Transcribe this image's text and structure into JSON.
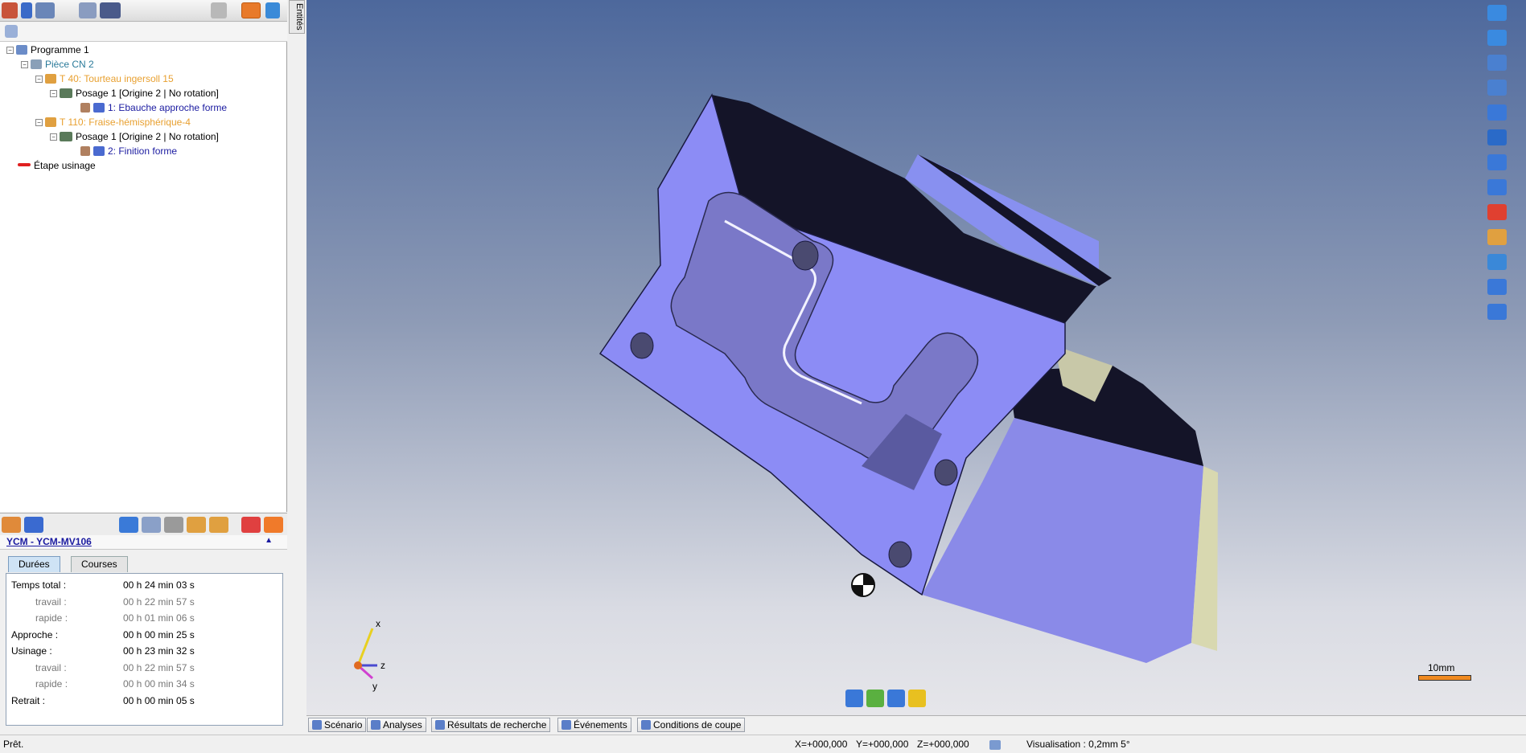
{
  "side_tab": "Entités",
  "tree": {
    "root": "Programme 1",
    "piece": "Pièce CN 2",
    "tool1": "T 40: Tourteau ingersoll 15",
    "posage1": "Posage 1 [Origine 2 | No rotation]",
    "op1": "1: Ebauche approche forme",
    "tool2": "T 110: Fraise-hémisphérique-4",
    "posage2": "Posage 1 [Origine 2 | No rotation]",
    "op2": "2: Finition forme",
    "etape": "Étape usinage"
  },
  "machine": {
    "name": "YCM - YCM-MV106",
    "collapse_glyph": "▲"
  },
  "tabs": {
    "durees": "Durées",
    "courses": "Courses"
  },
  "times": [
    {
      "label": "Temps total :",
      "value": "00 h 24 min 03 s",
      "sub": false
    },
    {
      "label": "travail :",
      "value": "00 h 22 min 57 s",
      "sub": true
    },
    {
      "label": "rapide :",
      "value": "00 h 01 min 06 s",
      "sub": true
    },
    {
      "label": "Approche :",
      "value": "00 h 00 min 25 s",
      "sub": false
    },
    {
      "label": "Usinage :",
      "value": "00 h 23 min 32 s",
      "sub": false
    },
    {
      "label": "travail :",
      "value": "00 h 22 min 57 s",
      "sub": true
    },
    {
      "label": "rapide :",
      "value": "00 h 00 min 34 s",
      "sub": true
    },
    {
      "label": "Retrait :",
      "value": "00 h 00 min 05 s",
      "sub": false
    }
  ],
  "viewport": {
    "scale_label": "10mm",
    "axis": {
      "x": "x",
      "y": "y",
      "z": "z"
    },
    "part_color": "#8c8cf5",
    "scale_color": "#f08a20"
  },
  "bottom_tabs": {
    "scenario": "Scénario",
    "analyses": "Analyses",
    "resultats": "Résultats de recherche",
    "evenements": "Événements",
    "conditions": "Conditions de coupe"
  },
  "status": {
    "ready": "Prêt.",
    "x": "X=+000,000",
    "y": "Y=+000,000",
    "z": "Z=+000,000",
    "visualisation": "Visualisation : 0,2mm 5°"
  },
  "colors": {
    "tool_orange": "#e8a030",
    "op_blue": "#1a1aa0",
    "piece_teal": "#2a7a9a"
  }
}
